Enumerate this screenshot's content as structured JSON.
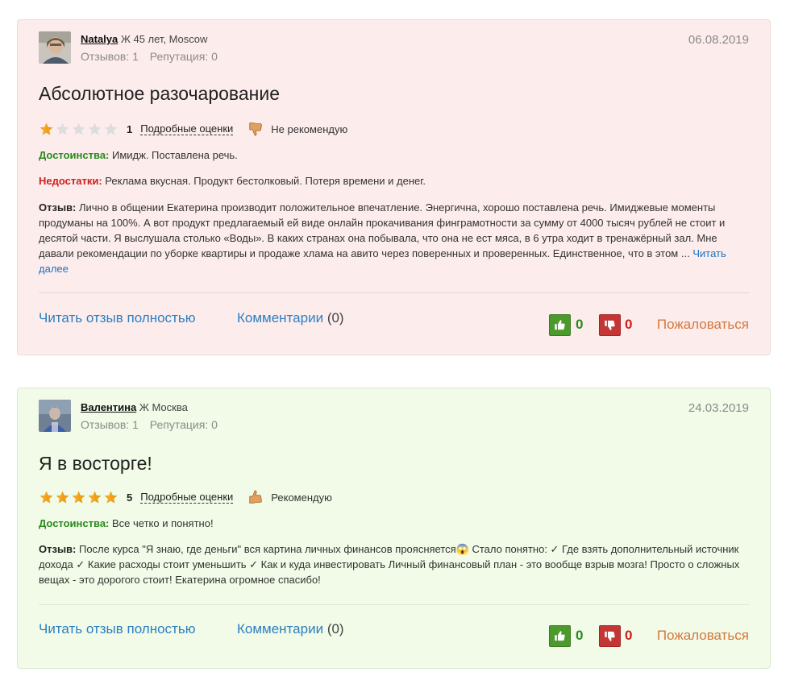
{
  "colors": {
    "positive": "#2a8a1f",
    "negative": "#cf1d1d",
    "link": "#2b7fc1",
    "report": "#d5773b",
    "star": "#f5a623"
  },
  "reviews": [
    {
      "user": {
        "name": "Natalya",
        "meta": " Ж 45 лет, Moscow",
        "reviews": "Отзывов: 1",
        "reputation": "Репутация: 0"
      },
      "date": "06.08.2019",
      "title": "Абсолютное разочарование",
      "rating": "1",
      "rating_fraction": 0.2,
      "details_label": "Подробные оценки",
      "recommend": "Не рекомендую",
      "recommend_icon": "thumbs-down-icon",
      "pros_label": "Достоинства:",
      "pros": " Имидж. Поставлена речь.",
      "cons_label": "Недостатки:",
      "cons": " Реклама вкусная. Продукт бестолковый. Потеря времени и денег.",
      "review_label": "Отзыв:",
      "review": " Лично в общении Екатерина производит положительное впечатление. Энергична, хорошо поставлена речь. Имиджевые моменты продуманы на 100%. А вот продукт предлагаемый ей виде онлайн прокачивания финграмотности за сумму от 4000 тысяч рублей не стоит и десятой части. Я выслушала столько «Воды». В каких странах она побывала, что она не ест мяса, в 6 утра ходит в тренажёрный зал. Мне давали рекомендации по уборке квартиры и продаже хлама на авито через поверенных и проверенных. Единственное, что в этом ...",
      "read_more": "Читать далее",
      "read_full": "Читать отзыв полностью",
      "comments": "Комментарии",
      "comments_count": "(0)",
      "likes": "0",
      "dislikes": "0",
      "report": "Пожаловаться"
    },
    {
      "user": {
        "name": "Валентина",
        "meta": " Ж Москва",
        "reviews": "Отзывов: 1",
        "reputation": "Репутация: 0"
      },
      "date": "24.03.2019",
      "title": "Я в восторге!",
      "rating": "5",
      "rating_fraction": 1.0,
      "details_label": "Подробные оценки",
      "recommend": "Рекомендую",
      "recommend_icon": "thumbs-up-icon",
      "pros_label": "Достоинства:",
      "pros": " Все четко и понятно!",
      "review_label": "Отзыв:",
      "review": " После курса \"Я знаю, где деньги\" вся картина личных финансов проясняется😱 Стало понятно: ✓ Где взять дополнительный источник дохода ✓ Какие расходы стоит уменьшить ✓ Как и куда инвестировать Личный финансовый план - это вообще взрыв мозга! Просто о сложных вещах - это дорогого стоит! Екатерина огромное спасибо!",
      "read_full": "Читать отзыв полностью",
      "comments": "Комментарии",
      "comments_count": "(0)",
      "likes": "0",
      "dislikes": "0",
      "report": "Пожаловаться"
    }
  ]
}
